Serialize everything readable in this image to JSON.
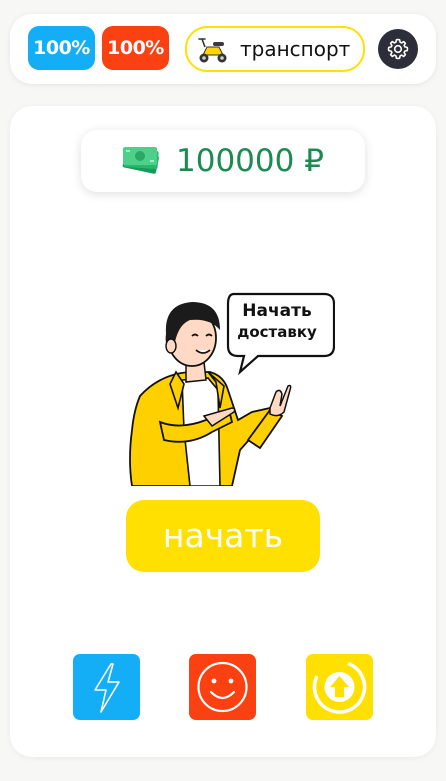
{
  "header": {
    "energy_label": "100%",
    "mood_label": "100%",
    "transport_label": "транспорт",
    "transport_icon": "scooter-icon",
    "settings_icon": "gear-icon"
  },
  "balance": {
    "amount": "100000 ₽",
    "icon": "cash-icon"
  },
  "speech_bubble": {
    "line1": "Начать",
    "line2": "доставку"
  },
  "start_button_label": "начать",
  "actions": [
    {
      "icon": "lightning-icon",
      "color": "#13aef5"
    },
    {
      "icon": "smiley-icon",
      "color": "#fb4111"
    },
    {
      "icon": "upgrade-arrow-icon",
      "color": "#ffe000"
    }
  ],
  "colors": {
    "energy": "#13aef5",
    "mood": "#fb4111",
    "accent_yellow": "#ffe000",
    "money_green": "#1d8a52",
    "settings_dark": "#2c2f3a"
  }
}
